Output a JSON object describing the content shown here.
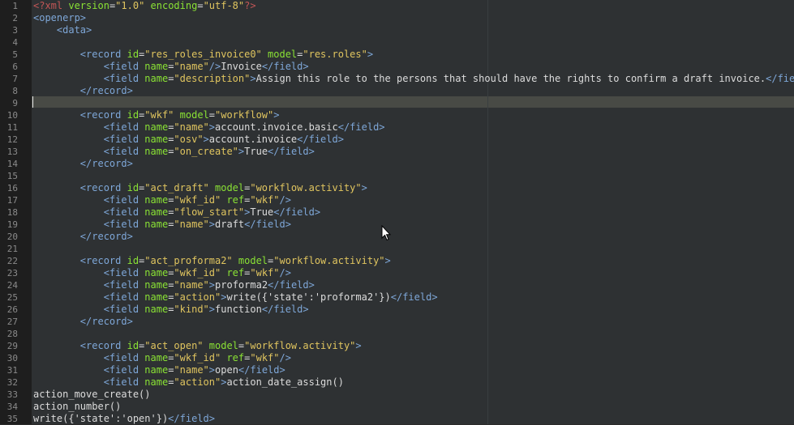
{
  "editor": {
    "lines": [
      {
        "n": "1",
        "tokens": [
          {
            "t": "pi",
            "v": "<?xml "
          },
          {
            "t": "attr",
            "v": "version"
          },
          {
            "t": "text",
            "v": "="
          },
          {
            "t": "val",
            "v": "\"1.0\""
          },
          {
            "t": "text",
            "v": " "
          },
          {
            "t": "attr",
            "v": "encoding"
          },
          {
            "t": "text",
            "v": "="
          },
          {
            "t": "val",
            "v": "\"utf-8\""
          },
          {
            "t": "pi",
            "v": "?>"
          }
        ]
      },
      {
        "n": "2",
        "tokens": [
          {
            "t": "tag",
            "v": "<openerp>"
          }
        ]
      },
      {
        "n": "3",
        "tokens": [
          {
            "t": "text",
            "v": "    "
          },
          {
            "t": "tag",
            "v": "<data>"
          }
        ]
      },
      {
        "n": "4",
        "tokens": []
      },
      {
        "n": "5",
        "tokens": [
          {
            "t": "text",
            "v": "        "
          },
          {
            "t": "tag",
            "v": "<record "
          },
          {
            "t": "attr",
            "v": "id"
          },
          {
            "t": "text",
            "v": "="
          },
          {
            "t": "val",
            "v": "\"res_roles_invoice0\""
          },
          {
            "t": "text",
            "v": " "
          },
          {
            "t": "attr",
            "v": "model"
          },
          {
            "t": "text",
            "v": "="
          },
          {
            "t": "val",
            "v": "\"res.roles\""
          },
          {
            "t": "tag",
            "v": ">"
          }
        ]
      },
      {
        "n": "6",
        "tokens": [
          {
            "t": "text",
            "v": "            "
          },
          {
            "t": "tag",
            "v": "<field "
          },
          {
            "t": "attr",
            "v": "name"
          },
          {
            "t": "text",
            "v": "="
          },
          {
            "t": "val",
            "v": "\"name\""
          },
          {
            "t": "tag",
            "v": "/>"
          },
          {
            "t": "text",
            "v": "Invoice"
          },
          {
            "t": "tag",
            "v": "</field>"
          }
        ]
      },
      {
        "n": "7",
        "tokens": [
          {
            "t": "text",
            "v": "            "
          },
          {
            "t": "tag",
            "v": "<field "
          },
          {
            "t": "attr",
            "v": "name"
          },
          {
            "t": "text",
            "v": "="
          },
          {
            "t": "val",
            "v": "\"description\""
          },
          {
            "t": "tag",
            "v": ">"
          },
          {
            "t": "text",
            "v": "Assign this role to the persons that should have the rights to confirm a draft invoice."
          },
          {
            "t": "tag",
            "v": "</field>"
          }
        ]
      },
      {
        "n": "8",
        "tokens": [
          {
            "t": "text",
            "v": "        "
          },
          {
            "t": "tag",
            "v": "</record>"
          }
        ]
      },
      {
        "n": "9",
        "tokens": []
      },
      {
        "n": "10",
        "tokens": [
          {
            "t": "text",
            "v": "        "
          },
          {
            "t": "tag",
            "v": "<record "
          },
          {
            "t": "attr",
            "v": "id"
          },
          {
            "t": "text",
            "v": "="
          },
          {
            "t": "val",
            "v": "\"wkf\""
          },
          {
            "t": "text",
            "v": " "
          },
          {
            "t": "attr",
            "v": "model"
          },
          {
            "t": "text",
            "v": "="
          },
          {
            "t": "val",
            "v": "\"workflow\""
          },
          {
            "t": "tag",
            "v": ">"
          }
        ]
      },
      {
        "n": "11",
        "tokens": [
          {
            "t": "text",
            "v": "            "
          },
          {
            "t": "tag",
            "v": "<field "
          },
          {
            "t": "attr",
            "v": "name"
          },
          {
            "t": "text",
            "v": "="
          },
          {
            "t": "val",
            "v": "\"name\""
          },
          {
            "t": "tag",
            "v": ">"
          },
          {
            "t": "text",
            "v": "account.invoice.basic"
          },
          {
            "t": "tag",
            "v": "</field>"
          }
        ]
      },
      {
        "n": "12",
        "tokens": [
          {
            "t": "text",
            "v": "            "
          },
          {
            "t": "tag",
            "v": "<field "
          },
          {
            "t": "attr",
            "v": "name"
          },
          {
            "t": "text",
            "v": "="
          },
          {
            "t": "val",
            "v": "\"osv\""
          },
          {
            "t": "tag",
            "v": ">"
          },
          {
            "t": "text",
            "v": "account.invoice"
          },
          {
            "t": "tag",
            "v": "</field>"
          }
        ]
      },
      {
        "n": "13",
        "tokens": [
          {
            "t": "text",
            "v": "            "
          },
          {
            "t": "tag",
            "v": "<field "
          },
          {
            "t": "attr",
            "v": "name"
          },
          {
            "t": "text",
            "v": "="
          },
          {
            "t": "val",
            "v": "\"on_create\""
          },
          {
            "t": "tag",
            "v": ">"
          },
          {
            "t": "text",
            "v": "True"
          },
          {
            "t": "tag",
            "v": "</field>"
          }
        ]
      },
      {
        "n": "14",
        "tokens": [
          {
            "t": "text",
            "v": "        "
          },
          {
            "t": "tag",
            "v": "</record>"
          }
        ]
      },
      {
        "n": "15",
        "tokens": []
      },
      {
        "n": "16",
        "tokens": [
          {
            "t": "text",
            "v": "        "
          },
          {
            "t": "tag",
            "v": "<record "
          },
          {
            "t": "attr",
            "v": "id"
          },
          {
            "t": "text",
            "v": "="
          },
          {
            "t": "val",
            "v": "\"act_draft\""
          },
          {
            "t": "text",
            "v": " "
          },
          {
            "t": "attr",
            "v": "model"
          },
          {
            "t": "text",
            "v": "="
          },
          {
            "t": "val",
            "v": "\"workflow.activity\""
          },
          {
            "t": "tag",
            "v": ">"
          }
        ]
      },
      {
        "n": "17",
        "tokens": [
          {
            "t": "text",
            "v": "            "
          },
          {
            "t": "tag",
            "v": "<field "
          },
          {
            "t": "attr",
            "v": "name"
          },
          {
            "t": "text",
            "v": "="
          },
          {
            "t": "val",
            "v": "\"wkf_id\""
          },
          {
            "t": "text",
            "v": " "
          },
          {
            "t": "attr",
            "v": "ref"
          },
          {
            "t": "text",
            "v": "="
          },
          {
            "t": "val",
            "v": "\"wkf\""
          },
          {
            "t": "tag",
            "v": "/>"
          }
        ]
      },
      {
        "n": "18",
        "tokens": [
          {
            "t": "text",
            "v": "            "
          },
          {
            "t": "tag",
            "v": "<field "
          },
          {
            "t": "attr",
            "v": "name"
          },
          {
            "t": "text",
            "v": "="
          },
          {
            "t": "val",
            "v": "\"flow_start\""
          },
          {
            "t": "tag",
            "v": ">"
          },
          {
            "t": "text",
            "v": "True"
          },
          {
            "t": "tag",
            "v": "</field>"
          }
        ]
      },
      {
        "n": "19",
        "tokens": [
          {
            "t": "text",
            "v": "            "
          },
          {
            "t": "tag",
            "v": "<field "
          },
          {
            "t": "attr",
            "v": "name"
          },
          {
            "t": "text",
            "v": "="
          },
          {
            "t": "val",
            "v": "\"name\""
          },
          {
            "t": "tag",
            "v": ">"
          },
          {
            "t": "text",
            "v": "draft"
          },
          {
            "t": "tag",
            "v": "</field>"
          }
        ]
      },
      {
        "n": "20",
        "tokens": [
          {
            "t": "text",
            "v": "        "
          },
          {
            "t": "tag",
            "v": "</record>"
          }
        ]
      },
      {
        "n": "21",
        "tokens": []
      },
      {
        "n": "22",
        "tokens": [
          {
            "t": "text",
            "v": "        "
          },
          {
            "t": "tag",
            "v": "<record "
          },
          {
            "t": "attr",
            "v": "id"
          },
          {
            "t": "text",
            "v": "="
          },
          {
            "t": "val",
            "v": "\"act_proforma2\""
          },
          {
            "t": "text",
            "v": " "
          },
          {
            "t": "attr",
            "v": "model"
          },
          {
            "t": "text",
            "v": "="
          },
          {
            "t": "val",
            "v": "\"workflow.activity\""
          },
          {
            "t": "tag",
            "v": ">"
          }
        ]
      },
      {
        "n": "23",
        "tokens": [
          {
            "t": "text",
            "v": "            "
          },
          {
            "t": "tag",
            "v": "<field "
          },
          {
            "t": "attr",
            "v": "name"
          },
          {
            "t": "text",
            "v": "="
          },
          {
            "t": "val",
            "v": "\"wkf_id\""
          },
          {
            "t": "text",
            "v": " "
          },
          {
            "t": "attr",
            "v": "ref"
          },
          {
            "t": "text",
            "v": "="
          },
          {
            "t": "val",
            "v": "\"wkf\""
          },
          {
            "t": "tag",
            "v": "/>"
          }
        ]
      },
      {
        "n": "24",
        "tokens": [
          {
            "t": "text",
            "v": "            "
          },
          {
            "t": "tag",
            "v": "<field "
          },
          {
            "t": "attr",
            "v": "name"
          },
          {
            "t": "text",
            "v": "="
          },
          {
            "t": "val",
            "v": "\"name\""
          },
          {
            "t": "tag",
            "v": ">"
          },
          {
            "t": "text",
            "v": "proforma2"
          },
          {
            "t": "tag",
            "v": "</field>"
          }
        ]
      },
      {
        "n": "25",
        "tokens": [
          {
            "t": "text",
            "v": "            "
          },
          {
            "t": "tag",
            "v": "<field "
          },
          {
            "t": "attr",
            "v": "name"
          },
          {
            "t": "text",
            "v": "="
          },
          {
            "t": "val",
            "v": "\"action\""
          },
          {
            "t": "tag",
            "v": ">"
          },
          {
            "t": "text",
            "v": "write({'state':'proforma2'})"
          },
          {
            "t": "tag",
            "v": "</field>"
          }
        ]
      },
      {
        "n": "26",
        "tokens": [
          {
            "t": "text",
            "v": "            "
          },
          {
            "t": "tag",
            "v": "<field "
          },
          {
            "t": "attr",
            "v": "name"
          },
          {
            "t": "text",
            "v": "="
          },
          {
            "t": "val",
            "v": "\"kind\""
          },
          {
            "t": "tag",
            "v": ">"
          },
          {
            "t": "text",
            "v": "function"
          },
          {
            "t": "tag",
            "v": "</field>"
          }
        ]
      },
      {
        "n": "27",
        "tokens": [
          {
            "t": "text",
            "v": "        "
          },
          {
            "t": "tag",
            "v": "</record>"
          }
        ]
      },
      {
        "n": "28",
        "tokens": []
      },
      {
        "n": "29",
        "tokens": [
          {
            "t": "text",
            "v": "        "
          },
          {
            "t": "tag",
            "v": "<record "
          },
          {
            "t": "attr",
            "v": "id"
          },
          {
            "t": "text",
            "v": "="
          },
          {
            "t": "val",
            "v": "\"act_open\""
          },
          {
            "t": "text",
            "v": " "
          },
          {
            "t": "attr",
            "v": "model"
          },
          {
            "t": "text",
            "v": "="
          },
          {
            "t": "val",
            "v": "\"workflow.activity\""
          },
          {
            "t": "tag",
            "v": ">"
          }
        ]
      },
      {
        "n": "30",
        "tokens": [
          {
            "t": "text",
            "v": "            "
          },
          {
            "t": "tag",
            "v": "<field "
          },
          {
            "t": "attr",
            "v": "name"
          },
          {
            "t": "text",
            "v": "="
          },
          {
            "t": "val",
            "v": "\"wkf_id\""
          },
          {
            "t": "text",
            "v": " "
          },
          {
            "t": "attr",
            "v": "ref"
          },
          {
            "t": "text",
            "v": "="
          },
          {
            "t": "val",
            "v": "\"wkf\""
          },
          {
            "t": "tag",
            "v": "/>"
          }
        ]
      },
      {
        "n": "31",
        "tokens": [
          {
            "t": "text",
            "v": "            "
          },
          {
            "t": "tag",
            "v": "<field "
          },
          {
            "t": "attr",
            "v": "name"
          },
          {
            "t": "text",
            "v": "="
          },
          {
            "t": "val",
            "v": "\"name\""
          },
          {
            "t": "tag",
            "v": ">"
          },
          {
            "t": "text",
            "v": "open"
          },
          {
            "t": "tag",
            "v": "</field>"
          }
        ]
      },
      {
        "n": "32",
        "tokens": [
          {
            "t": "text",
            "v": "            "
          },
          {
            "t": "tag",
            "v": "<field "
          },
          {
            "t": "attr",
            "v": "name"
          },
          {
            "t": "text",
            "v": "="
          },
          {
            "t": "val",
            "v": "\"action\""
          },
          {
            "t": "tag",
            "v": ">"
          },
          {
            "t": "text",
            "v": "action_date_assign()"
          }
        ]
      },
      {
        "n": "33",
        "tokens": [
          {
            "t": "text",
            "v": "action_move_create()"
          }
        ]
      },
      {
        "n": "34",
        "tokens": [
          {
            "t": "text",
            "v": "action_number()"
          }
        ]
      },
      {
        "n": "35",
        "tokens": [
          {
            "t": "text",
            "v": "write({'state':'open'})"
          },
          {
            "t": "tag",
            "v": "</field>"
          }
        ]
      }
    ]
  },
  "colors": {
    "background": "#2e3133",
    "gutter": "#1e1e1e",
    "current_line": "#484a45",
    "tag": "#7ea7d8",
    "attribute": "#8ae234",
    "value": "#e0c55f",
    "processing_instruction": "#c25656",
    "text": "#dcdcdc"
  },
  "icons": {
    "mouse_pointer": "arrow-cursor-icon"
  }
}
